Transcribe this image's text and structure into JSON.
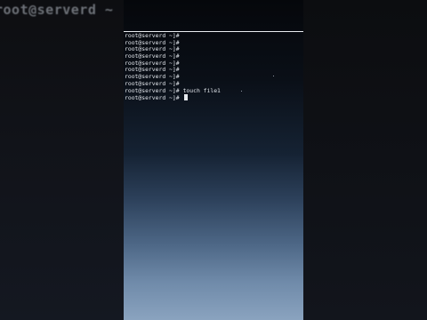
{
  "background": {
    "title": "root@serverd ~"
  },
  "terminal": {
    "lines": [
      {
        "prompt": "root@serverd ~]#",
        "command": ""
      },
      {
        "prompt": "root@serverd ~]#",
        "command": ""
      },
      {
        "prompt": "root@serverd ~]#",
        "command": ""
      },
      {
        "prompt": "root@serverd ~]#",
        "command": ""
      },
      {
        "prompt": "root@serverd ~]#",
        "command": ""
      },
      {
        "prompt": "root@serverd ~]#",
        "command": ""
      },
      {
        "prompt": "root@serverd ~]#",
        "command": ""
      },
      {
        "prompt": "root@serverd ~]#",
        "command": ""
      },
      {
        "prompt": "root@serverd ~]#",
        "command": "touch file1"
      },
      {
        "prompt": "root@serverd ~]#",
        "command": ""
      }
    ]
  },
  "colors": {
    "terminal_text": "#e2e6ec",
    "background": "#000000"
  }
}
